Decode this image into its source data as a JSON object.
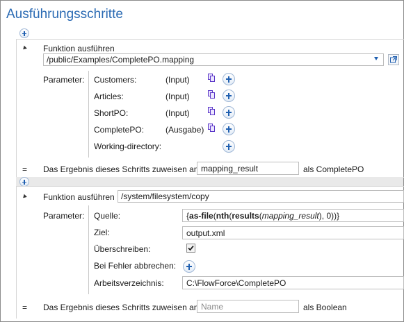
{
  "title": "Ausführungsschritte",
  "step1": {
    "heading": "Funktion ausführen",
    "path": "/public/Examples/CompletePO.mapping",
    "params_label": "Parameter:",
    "params": [
      {
        "name": "Customers:",
        "kind": "(Input)"
      },
      {
        "name": "Articles:",
        "kind": "(Input)"
      },
      {
        "name": "ShortPO:",
        "kind": "(Input)"
      },
      {
        "name": "CompletePO:",
        "kind": "(Ausgabe)"
      },
      {
        "name": "Working-directory:",
        "kind": ""
      }
    ],
    "assign_eq": "=",
    "assign_text": "Das Ergebnis dieses Schritts zuweisen an",
    "assign_value": "mapping_result",
    "assign_type": "als CompletePO"
  },
  "step2": {
    "heading": "Funktion ausführen",
    "path": "/system/filesystem/copy",
    "params_label": "Parameter:",
    "quelle_label": "Quelle:",
    "quelle_expr": {
      "p1": "{",
      "fn1": "as-file",
      "p2": "(",
      "fn2": "nth",
      "p3": "(",
      "fn3": "results",
      "p4": "(",
      "var": "mapping_result",
      "p5": "), 0))}"
    },
    "ziel_label": "Ziel:",
    "ziel_value": "output.xml",
    "ueberschreiben_label": "Überschreiben:",
    "ueberschreiben_checked": true,
    "fehler_label": "Bei Fehler abbrechen:",
    "arbeit_label": "Arbeitsverzeichnis:",
    "arbeit_value": "C:\\FlowForce\\CompletePO",
    "assign_eq": "=",
    "assign_text": "Das Ergebnis dieses Schritts zuweisen an",
    "assign_placeholder": "Name",
    "assign_type": "als Boolean"
  },
  "colors": {
    "title": "#2a6ab3",
    "accent": "#1f5fb0"
  }
}
